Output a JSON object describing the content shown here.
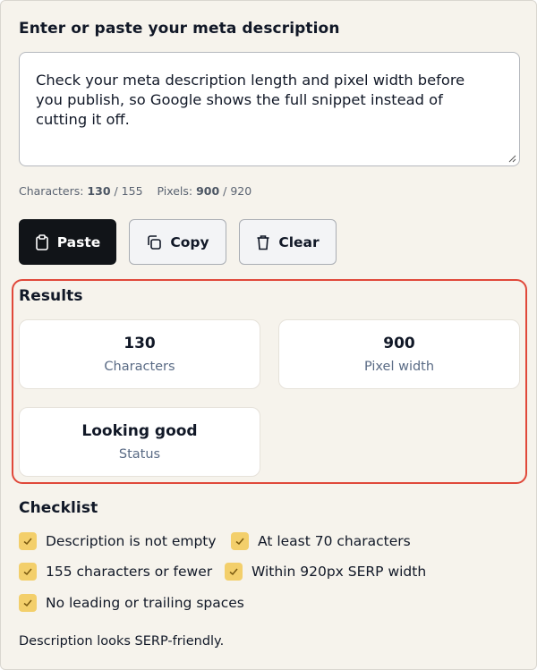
{
  "editor": {
    "heading": "Enter or paste your meta description",
    "text_line1": "Check your meta description length and pixel width before",
    "text_line2": "you publish, so Google shows the full snippet instead of",
    "text_line3": "cutting it off."
  },
  "counts": {
    "chars_label": "Characters:",
    "chars_value": "130",
    "chars_max": "/ 155",
    "pixels_label": "Pixels:",
    "pixels_value": "900",
    "pixels_max": "/ 920"
  },
  "toolbar": {
    "paste_label": "Paste",
    "copy_label": "Copy",
    "clear_label": "Clear",
    "paste_icon": "clipboard-icon",
    "copy_icon": "copy-icon",
    "clear_icon": "trash-icon"
  },
  "results": {
    "heading": "Results",
    "cards": [
      {
        "value": "130",
        "label": "Characters"
      },
      {
        "value": "900",
        "label": "Pixel width"
      },
      {
        "value": "Looking good",
        "label": "Status"
      }
    ],
    "highlight_color": "#e0483a"
  },
  "checklist": {
    "heading": "Checklist",
    "items": [
      {
        "label": "Description is not empty",
        "checked": true
      },
      {
        "label": "At least 70 characters",
        "checked": true
      },
      {
        "label": "155 characters or fewer",
        "checked": true
      },
      {
        "label": "Within 920px SERP width",
        "checked": true
      },
      {
        "label": "No leading or trailing spaces",
        "checked": true
      }
    ],
    "check_color": "#f3cf6b"
  },
  "footer": {
    "message": "Description looks SERP-friendly."
  }
}
